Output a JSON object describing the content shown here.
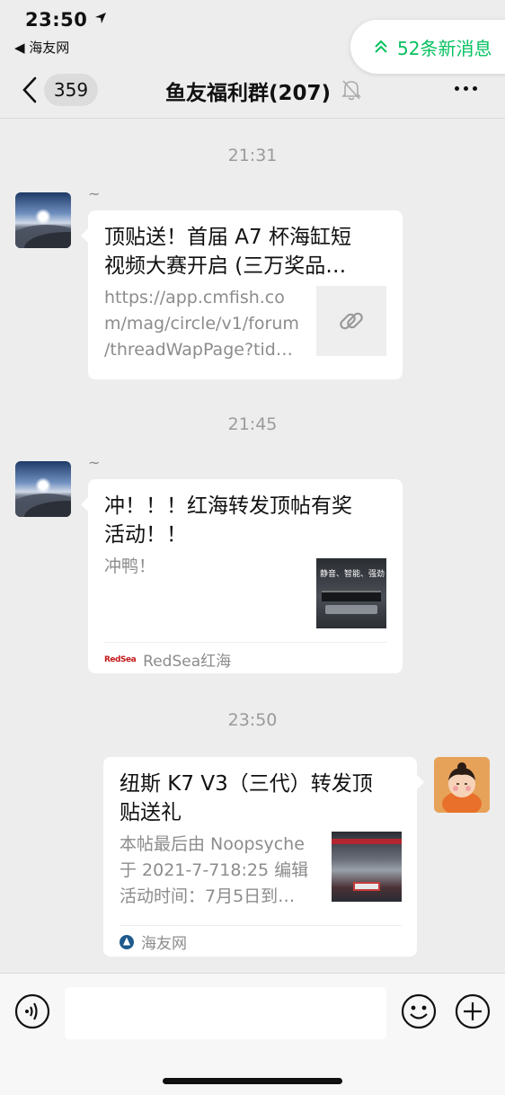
{
  "status_bar": {
    "time": "23:50",
    "back_app": "◀ 海友网",
    "battery_color": "#f2cb2b",
    "battery_level": 0.3
  },
  "new_messages": {
    "label": "52条新消息",
    "color": "#07c160",
    "icon": "double-chevron-up-icon"
  },
  "nav": {
    "unread_count": "359",
    "title": "鱼友福利群(207)",
    "icons": [
      "back-chevron-icon",
      "mute-bell-icon",
      "more-dots-icon"
    ]
  },
  "messages": [
    {
      "timestamp": "21:31",
      "sender": "~",
      "direction": "incoming",
      "card": {
        "title_line1": "顶贴送！首届 A7 杯海缸短",
        "title_line2": "视频大赛开启 (三万奖品…",
        "desc_line1": "https://app.cmfish.co",
        "desc_line2": "m/mag/circle/v1/forum",
        "desc_line3": "/threadWapPage?tid…",
        "thumb_icon": "link-icon"
      }
    },
    {
      "timestamp": "21:45",
      "sender": "~",
      "direction": "incoming",
      "card": {
        "title_line1": "冲！！！红海转发顶帖有奖",
        "title_line2": "活动！！",
        "desc_line1": "冲鸭！",
        "thumb_text": "静音、智能、强劲",
        "source_logo": "RedSea",
        "source": "RedSea红海"
      }
    },
    {
      "timestamp": "23:50",
      "direction": "outgoing",
      "card": {
        "title_line1": "纽斯 K7 V3（三代）转发顶",
        "title_line2": "贴送礼",
        "desc_line1": "本帖最后由 Noopsyche",
        "desc_line2": "于 2021-7-718:25 编辑",
        "desc_line3": "活动时间：7月5日到…",
        "source": "海友网"
      }
    }
  ],
  "toolbar": {
    "icons": [
      "voice-icon",
      "emoji-icon",
      "add-icon"
    ],
    "input_value": ""
  }
}
